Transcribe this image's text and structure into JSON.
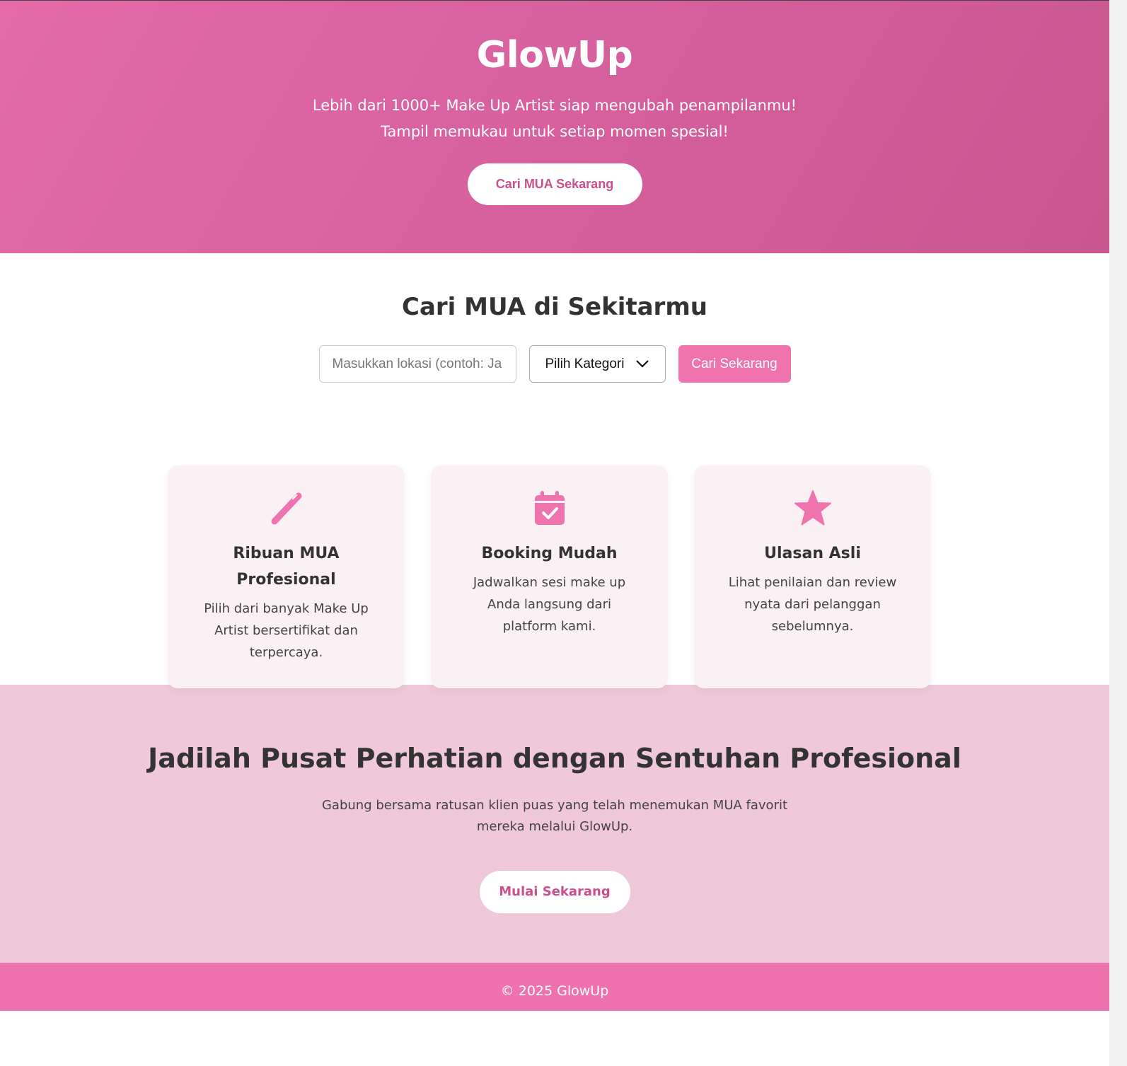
{
  "hero": {
    "title": "GlowUp",
    "subtitle_line1": "Lebih dari 1000+ Make Up Artist siap mengubah penampilanmu!",
    "subtitle_line2": "Tampil memukau untuk setiap momen spesial!",
    "cta_label": "Cari MUA Sekarang"
  },
  "search": {
    "title": "Cari MUA di Sekitarmu",
    "location_placeholder": "Masukkan lokasi (contoh: Ja",
    "category_selected": "Pilih Kategori",
    "button_label": "Cari Sekarang"
  },
  "features": [
    {
      "icon": "brush-icon",
      "title": "Ribuan MUA Profesional",
      "desc": "Pilih dari banyak Make Up Artist bersertifikat dan terpercaya."
    },
    {
      "icon": "calendar-check-icon",
      "title": "Booking Mudah",
      "desc": "Jadwalkan sesi make up Anda langsung dari platform kami."
    },
    {
      "icon": "star-icon",
      "title": "Ulasan Asli",
      "desc": "Lihat penilaian dan review nyata dari pelanggan sebelumnya."
    }
  ],
  "cta": {
    "title": "Jadilah Pusat Perhatian dengan Sentuhan Profesional",
    "desc": "Gabung bersama ratusan klien puas yang telah menemukan MUA favorit mereka melalui GlowUp.",
    "button_label": "Mulai Sekarang"
  },
  "footer": {
    "text": "© 2025 GlowUp"
  },
  "colors": {
    "primary": "#ef73ad",
    "hero_start": "#e46aa8",
    "hero_end": "#c9568f",
    "cta_bg": "#efc9da",
    "card_bg": "#fbf0f4",
    "accent_text": "#c9508e"
  }
}
